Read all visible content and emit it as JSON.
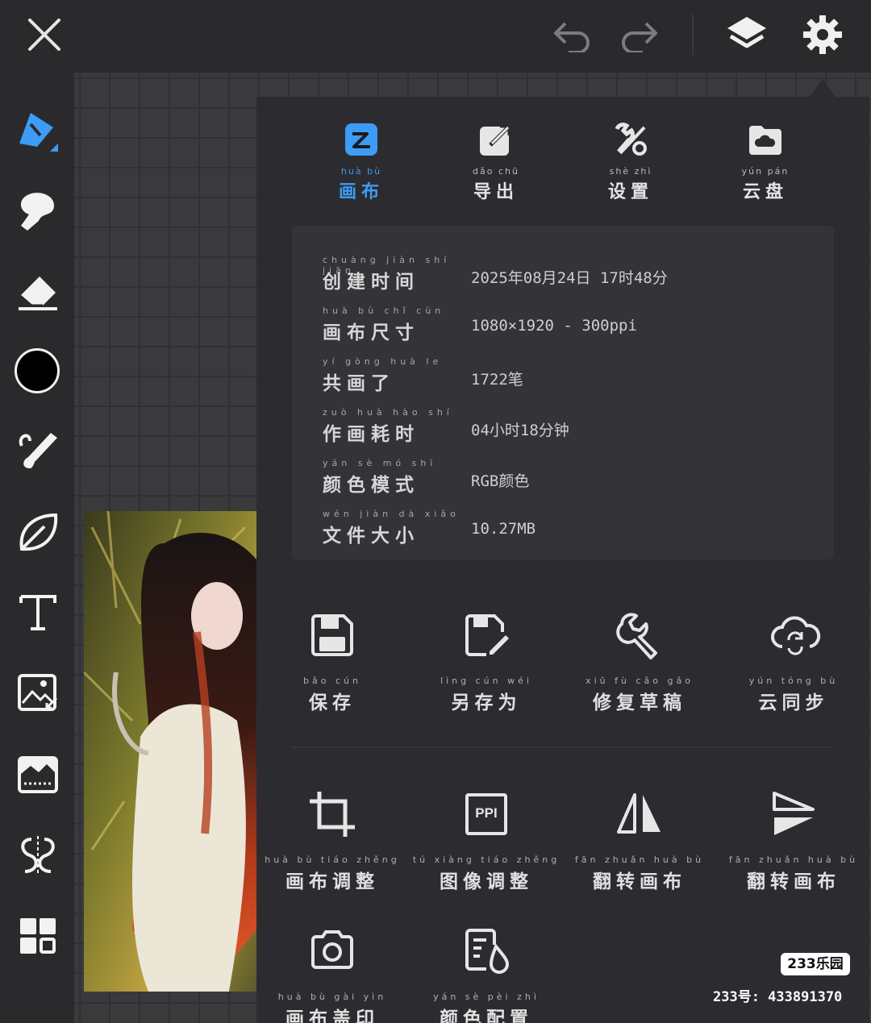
{
  "top_bar": {
    "close": "close-icon",
    "undo": "undo-icon",
    "redo": "redo-icon",
    "layers": "layers-icon",
    "settings": "gear-icon"
  },
  "toolbar": {
    "tools": [
      "pen-icon",
      "smudge-icon",
      "eraser-icon",
      "color-swatch",
      "brush-icon",
      "leaf-icon",
      "text-icon",
      "image-import-icon",
      "filter-icon",
      "symmetry-icon",
      "more-grid-icon"
    ],
    "current_color": "#000000",
    "active_accent": "#3d9cf5"
  },
  "tabs": [
    {
      "pinyin": "huà  bù",
      "label": "画布",
      "icon": "canvas-icon",
      "active": true
    },
    {
      "pinyin": "dǎo  chū",
      "label": "导出",
      "icon": "export-icon",
      "active": false
    },
    {
      "pinyin": "shè  zhì",
      "label": "设置",
      "icon": "tools-icon",
      "active": false
    },
    {
      "pinyin": "yún  pán",
      "label": "云盘",
      "icon": "cloud-folder-icon",
      "active": false
    }
  ],
  "info": [
    {
      "pinyin": "chuàng jiàn shí jiān",
      "label": "创建时间",
      "value": "2025年08月24日 17时48分"
    },
    {
      "pinyin": "huà bù chǐ cùn",
      "label": "画布尺寸",
      "value": "1080×1920 - 300ppi"
    },
    {
      "pinyin": "yí gòng huà le",
      "label": "共画了",
      "value": "1722笔"
    },
    {
      "pinyin": "zuò huà hào shí",
      "label": "作画耗时",
      "value": "04小时18分钟"
    },
    {
      "pinyin": "yán sè mó shì",
      "label": "颜色模式",
      "value": "RGB颜色"
    },
    {
      "pinyin": "wén jiàn dà xiǎo",
      "label": "文件大小",
      "value": "10.27MB"
    }
  ],
  "actions": [
    {
      "pinyin": "bǎo cún",
      "label": "保存",
      "icon": "save-icon"
    },
    {
      "pinyin": "lìng cún wéi",
      "label": "另存为",
      "icon": "save-as-icon"
    },
    {
      "pinyin": "xiū fù cǎo gǎo",
      "label": "修复草稿",
      "icon": "wrench-icon"
    },
    {
      "pinyin": "yún tóng bù",
      "label": "云同步",
      "icon": "cloud-sync-icon"
    },
    {
      "pinyin": "huà bù tiáo zhěng",
      "label": "画布调整",
      "icon": "crop-icon"
    },
    {
      "pinyin": "tú xiàng tiáo zhěng",
      "label": "图像调整",
      "icon": "ppi-icon"
    },
    {
      "pinyin": "fān zhuǎn huà bù",
      "label": "翻转画布",
      "icon": "flip-horizontal-icon"
    },
    {
      "pinyin": "fān zhuǎn huà bù",
      "label": "翻转画布",
      "icon": "flip-vertical-icon"
    },
    {
      "pinyin": "huà bù gài yìn",
      "label": "画布盖印",
      "icon": "camera-icon"
    },
    {
      "pinyin": "yán sè pèi zhì",
      "label": "颜色配置",
      "icon": "color-profile-icon"
    }
  ],
  "ppi_badge": "PPI",
  "watermark": {
    "brand": "233乐园",
    "id": "233号: 433891370"
  }
}
